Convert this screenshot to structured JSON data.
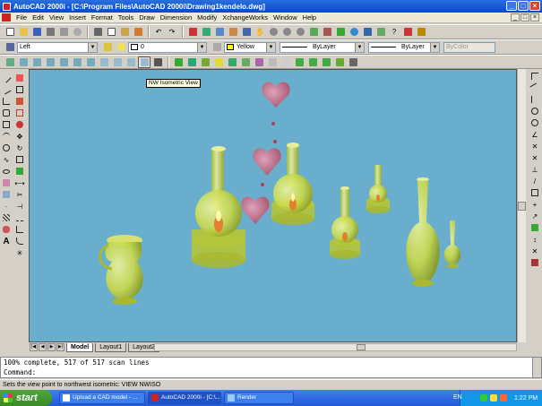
{
  "window": {
    "title": "AutoCAD 2000i - [C:\\Program Files\\AutoCAD 2000i\\Drawing1kendelo.dwg]",
    "btn_min": "_",
    "btn_max": "□",
    "btn_close": "×"
  },
  "menu": {
    "items": [
      "File",
      "Edit",
      "View",
      "Insert",
      "Format",
      "Tools",
      "Draw",
      "Dimension",
      "Modify",
      "XchangeWorks",
      "Window",
      "Help"
    ],
    "mdi_min": "_",
    "mdi_max": "□",
    "mdi_close": "×"
  },
  "layer_toolbar": {
    "view_combo": "Left",
    "layer_combo": "0",
    "color_combo": "Yellow",
    "linetype_combo": "ByLayer",
    "lineweight_combo": "ByLayer",
    "plotstyle_combo": "ByColor"
  },
  "tooltip": "NW Isometric View",
  "tabs": {
    "model": "Model",
    "layout1": "Layout1",
    "layout2": "Layout2"
  },
  "nav": {
    "first": "|◀",
    "prev": "◀",
    "next": "▶",
    "last": "▶|"
  },
  "command": {
    "line1": "100% complete, 517 of 517 scan lines",
    "line2": "Command:"
  },
  "status_text": "Sets the view point to northwest isometric:  VIEW NWISO",
  "taskbar": {
    "start": "start",
    "tasks": [
      "Upload a CAD model - ...",
      "AutoCAD 2000i - [C:\\...",
      "Render"
    ],
    "lang": "EN",
    "clock": "1:22 PM"
  },
  "colors": {
    "viewport_bg": "#6aaecd",
    "vase_fill": "#c9d94a",
    "heart_fill": "#c0506a",
    "titlebar": "#0a48c8"
  }
}
